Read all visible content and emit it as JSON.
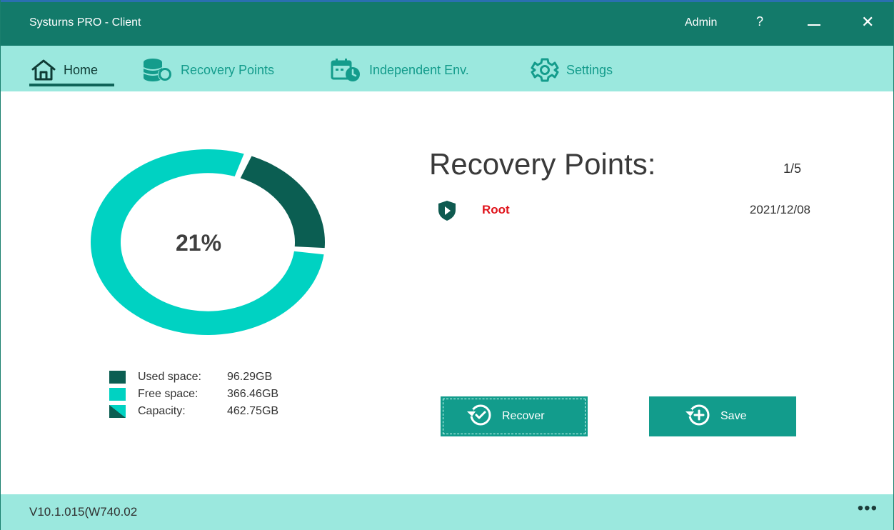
{
  "window": {
    "title": "Systurns PRO - Client",
    "admin_label": "Admin",
    "help_label": "?",
    "close_label": "✕"
  },
  "nav": {
    "items": [
      {
        "label": "Home",
        "icon": "home-icon",
        "active": true
      },
      {
        "label": "Recovery Points",
        "icon": "database-restore-icon",
        "active": false
      },
      {
        "label": "Independent Env.",
        "icon": "calendar-clock-icon",
        "active": false
      },
      {
        "label": "Settings",
        "icon": "gear-icon",
        "active": false
      }
    ]
  },
  "disk": {
    "used_percent_label": "21%",
    "used_fraction": 0.21,
    "legend": [
      {
        "label": "Used space:",
        "value": "96.29GB",
        "color": "#0b5e52"
      },
      {
        "label": "Free space:",
        "value": "366.46GB",
        "color": "#00d2c2"
      },
      {
        "label": "Capacity:",
        "value": "462.75GB",
        "color": "split"
      }
    ]
  },
  "recovery": {
    "title": "Recovery Points:",
    "count": "1/5",
    "points": [
      {
        "name": "Root",
        "date": "2021/12/08",
        "icon": "shield-play-icon"
      }
    ],
    "recover_label": "Recover",
    "save_label": "Save"
  },
  "footer": {
    "version": "V10.1.015(W740.02",
    "more_label": "•••"
  },
  "colors": {
    "titlebar": "#137a6a",
    "nav_bg": "#9be8de",
    "accent": "#129c8c",
    "used": "#0b5e52",
    "free": "#00d2c2",
    "root_red": "#e0141c"
  }
}
